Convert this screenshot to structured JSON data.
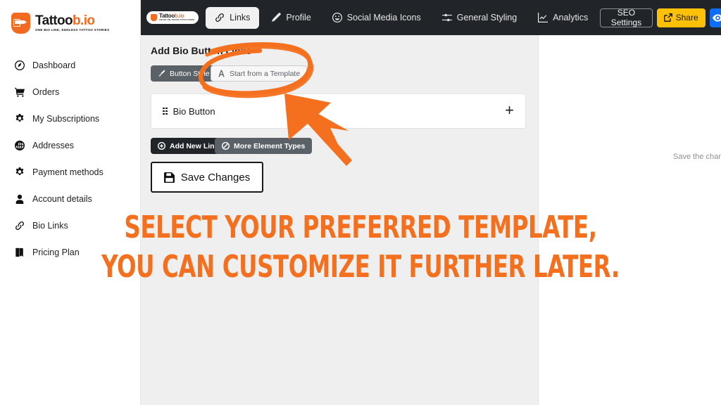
{
  "brand": {
    "name_main": "Tattoo",
    "name_accent": "b.io",
    "tagline": "ONE BIO LINK, ENDLESS TATTOO STORIES"
  },
  "sidebar": {
    "items": [
      {
        "label": "Dashboard",
        "icon": "dashboard-icon"
      },
      {
        "label": "Orders",
        "icon": "cart-icon"
      },
      {
        "label": "My Subscriptions",
        "icon": "gear-icon"
      },
      {
        "label": "Addresses",
        "icon": "globe-icon"
      },
      {
        "label": "Payment methods",
        "icon": "gear-icon"
      },
      {
        "label": "Account details",
        "icon": "user-icon"
      },
      {
        "label": "Bio Links",
        "icon": "link-icon"
      },
      {
        "label": "Pricing Plan",
        "icon": "book-icon"
      }
    ]
  },
  "topbar": {
    "tabs": [
      {
        "label": "Links",
        "icon": "link-icon",
        "active": true
      },
      {
        "label": "Profile",
        "icon": "pencil-icon",
        "active": false
      },
      {
        "label": "Social Media Icons",
        "icon": "smiley-icon",
        "active": false
      },
      {
        "label": "General Styling",
        "icon": "sliders-icon",
        "active": false
      },
      {
        "label": "Analytics",
        "icon": "chart-line-icon",
        "active": false
      }
    ],
    "seo_label": "SEO Settings",
    "share_label": "Share",
    "share_icon": "external-link-icon",
    "preview_icon": "eye-icon",
    "colors": {
      "bar": "#212529",
      "share": "#ffc107",
      "preview": "#0d6efd"
    }
  },
  "editor": {
    "section_title": "Add Bio Button Links",
    "button_style_label": "Button Style",
    "button_style_icon": "brush-icon",
    "template_label": "Start from a Template",
    "template_icon": "font-a-icon",
    "bio_row": {
      "label": "Bio Button",
      "handle_icon": "drag-handle-icon",
      "expand_icon": "plus-icon"
    },
    "add_new_link_label": "Add New Link",
    "add_new_link_icon": "plus-circle-icon",
    "more_element_types_label": "More Element Types",
    "more_element_types_icon": "ban-circle-icon",
    "save_label": "Save Changes",
    "save_icon": "floppy-disk-icon"
  },
  "preview": {
    "note": "Save the chan"
  },
  "annotation": {
    "caption_line1": "SELECT YOUR PREFERRED TEMPLATE,",
    "caption_line2": "YOU CAN CUSTOMIZE IT FURTHER LATER.",
    "color": "#f4701e",
    "circle_target": "Start from a Template",
    "arrow_icon": "arrow-up-left-icon"
  }
}
